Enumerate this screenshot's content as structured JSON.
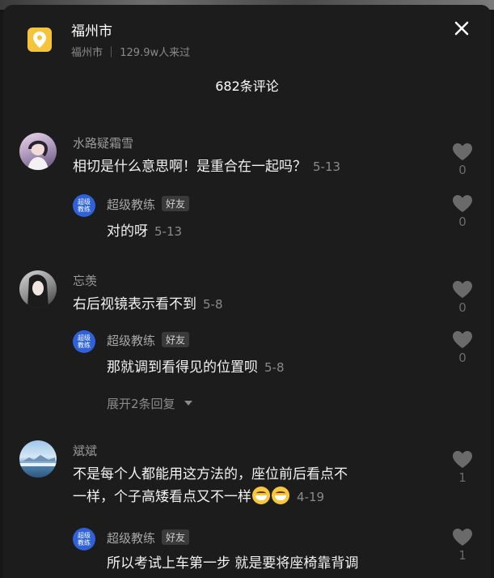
{
  "location": {
    "title": "福州市",
    "subtitle": "福州市 ｜ 129.9w人来过"
  },
  "comment_count": "682条评论",
  "friend_tag": "好友",
  "badge_text": [
    "超级",
    "教练"
  ],
  "comments": [
    {
      "user": "水路疑霜雪",
      "text": "相切是什么意思啊！是重合在一起吗？",
      "date": "5-13",
      "likes": "0",
      "reply": {
        "user": "超级教练",
        "text": "对的呀",
        "date": "5-13",
        "likes": "0"
      }
    },
    {
      "user": "忘羡",
      "text": "右后视镜表示看不到",
      "date": "5-8",
      "likes": "0",
      "reply": {
        "user": "超级教练",
        "text": "那就调到看得见的位置呗",
        "date": "5-8",
        "likes": "0"
      },
      "expand": "展开2条回复"
    },
    {
      "user": "斌斌",
      "text_line1": "不是每个人都能用这方法的，座位前后看点不",
      "text_line2": "一样，个子高矮看点又不一样",
      "date": "4-19",
      "likes": "1",
      "reply": {
        "user": "超级教练",
        "text": "所以考试上车第一步 就是要将座椅靠背调",
        "likes": "1"
      }
    }
  ]
}
